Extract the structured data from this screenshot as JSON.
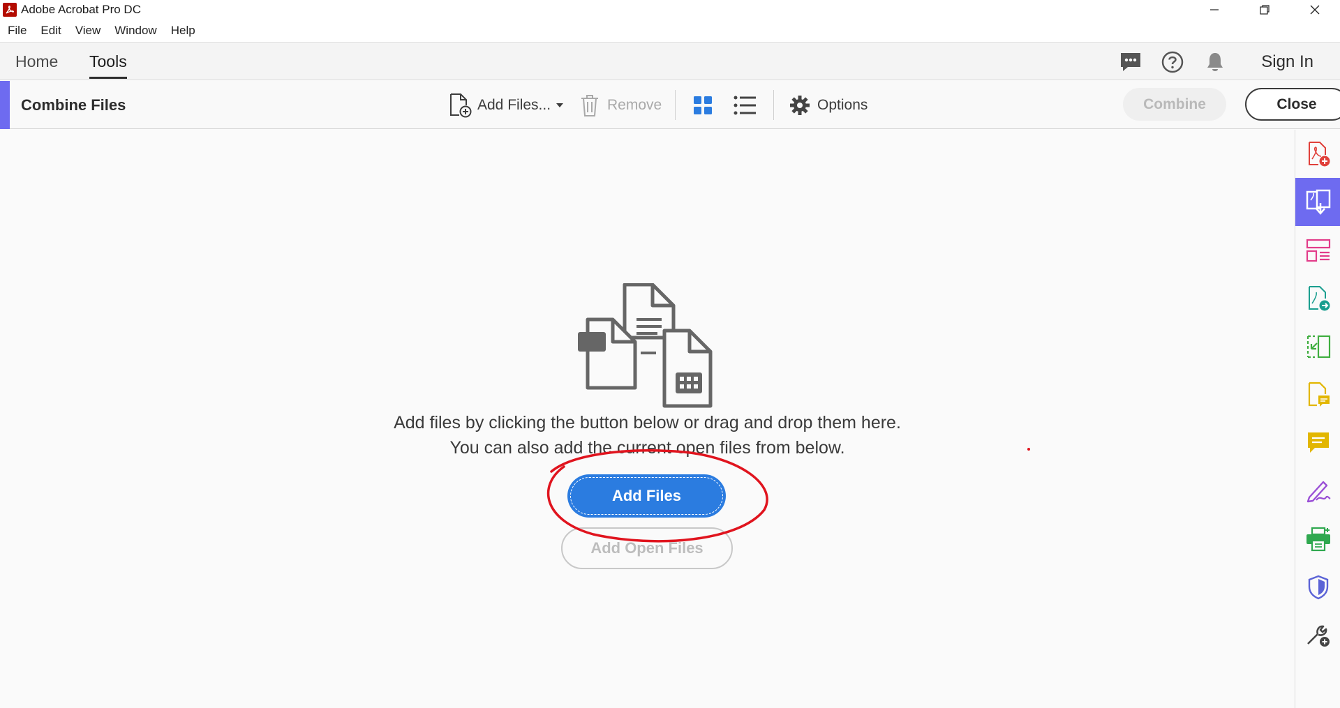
{
  "window": {
    "title": "Adobe Acrobat Pro DC"
  },
  "menu": [
    "File",
    "Edit",
    "View",
    "Window",
    "Help"
  ],
  "nav": {
    "tabs": [
      "Home",
      "Tools"
    ],
    "active_tab": "Tools",
    "sign_in": "Sign In"
  },
  "toolbar": {
    "title": "Combine Files",
    "add_files": "Add Files...",
    "remove": "Remove",
    "options": "Options",
    "combine": "Combine",
    "close": "Close"
  },
  "main": {
    "instruction_line1": "Add files by clicking the button below or drag and drop them here.",
    "instruction_line2": "You can also add the current open files from below.",
    "add_files_button": "Add Files",
    "add_open_files_button": "Add Open Files"
  },
  "right_rail": {
    "icons": [
      "create-pdf-icon",
      "combine-files-icon",
      "organize-pages-icon",
      "export-pdf-icon",
      "edit-pdf-icon",
      "comment-file-icon",
      "comment-icon",
      "fill-sign-icon",
      "print-production-icon",
      "protect-icon",
      "more-tools-icon"
    ],
    "active_index": 1
  },
  "colors": {
    "accent": "#6e6bf0",
    "primary_button": "#2b7ce0",
    "acrobat_red": "#b30b00",
    "annotation": "#e0141e"
  }
}
